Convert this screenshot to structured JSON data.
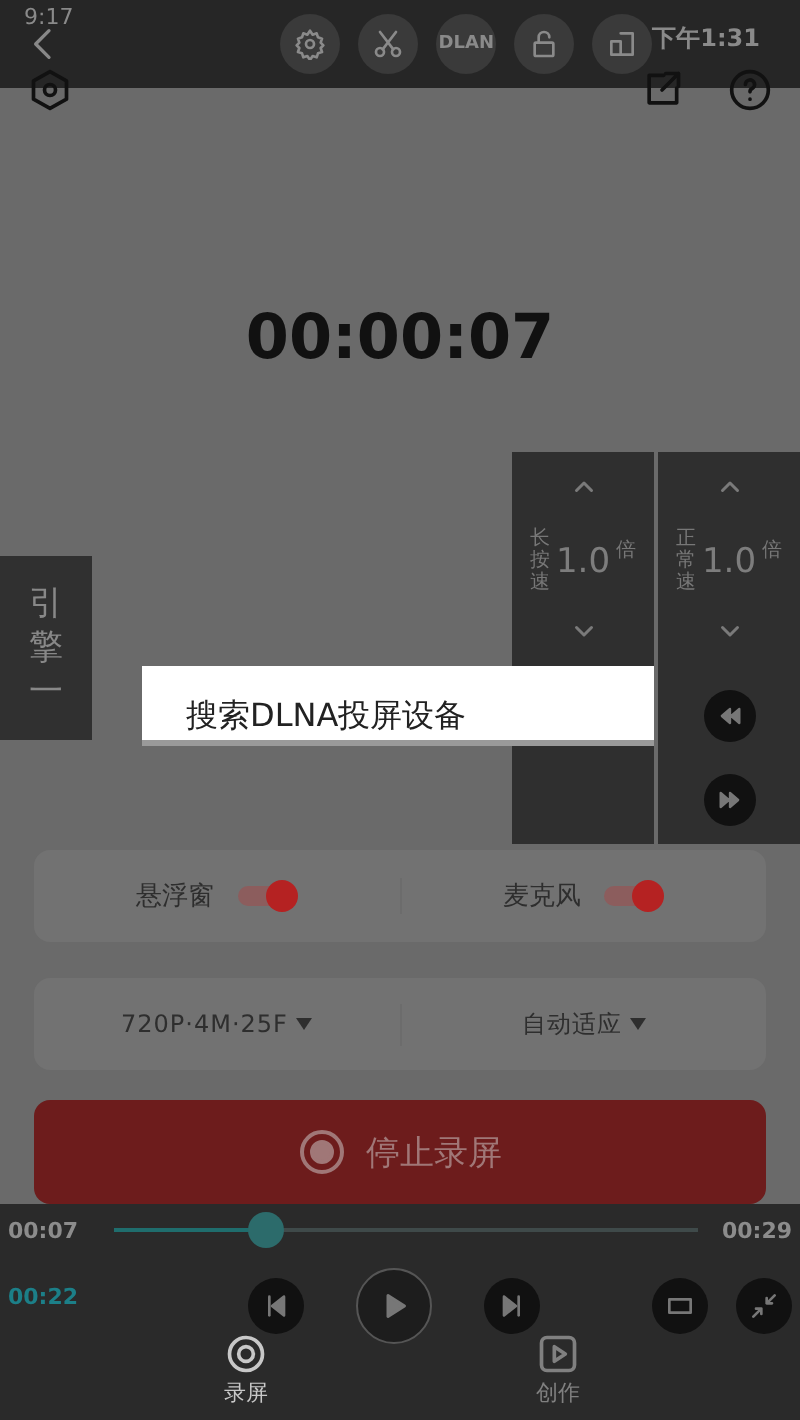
{
  "status_bar": {
    "time": "9:17",
    "clock": "下午1:31"
  },
  "toolbar": {
    "buttons": [
      {
        "kind": "gear"
      },
      {
        "kind": "scissors"
      },
      {
        "kind": "text",
        "label": "DLAN"
      },
      {
        "kind": "lock"
      },
      {
        "kind": "layout"
      }
    ]
  },
  "timer": "00:00:07",
  "engine_tab": {
    "label": "引擎一"
  },
  "speed_panel": {
    "columns": [
      {
        "label": "长按速",
        "value": "1.0",
        "unit": "倍"
      },
      {
        "label": "正常速",
        "value": "1.0",
        "unit": "倍"
      }
    ]
  },
  "popup": {
    "text": "搜索DLNA投屏设备"
  },
  "toggles": [
    {
      "label": "悬浮窗",
      "on": true
    },
    {
      "label": "麦克风",
      "on": true
    }
  ],
  "dropdowns": [
    {
      "value": "720P·4M·25F"
    },
    {
      "value": "自动适应"
    }
  ],
  "stop_button": {
    "label": "停止录屏"
  },
  "player": {
    "elapsed": "00:07",
    "total": "00:29",
    "level": 0.26,
    "clip_time": "00:22"
  },
  "bottom_nav": [
    {
      "label": "录屏",
      "selected": true
    },
    {
      "label": "创作",
      "selected": false
    }
  ]
}
